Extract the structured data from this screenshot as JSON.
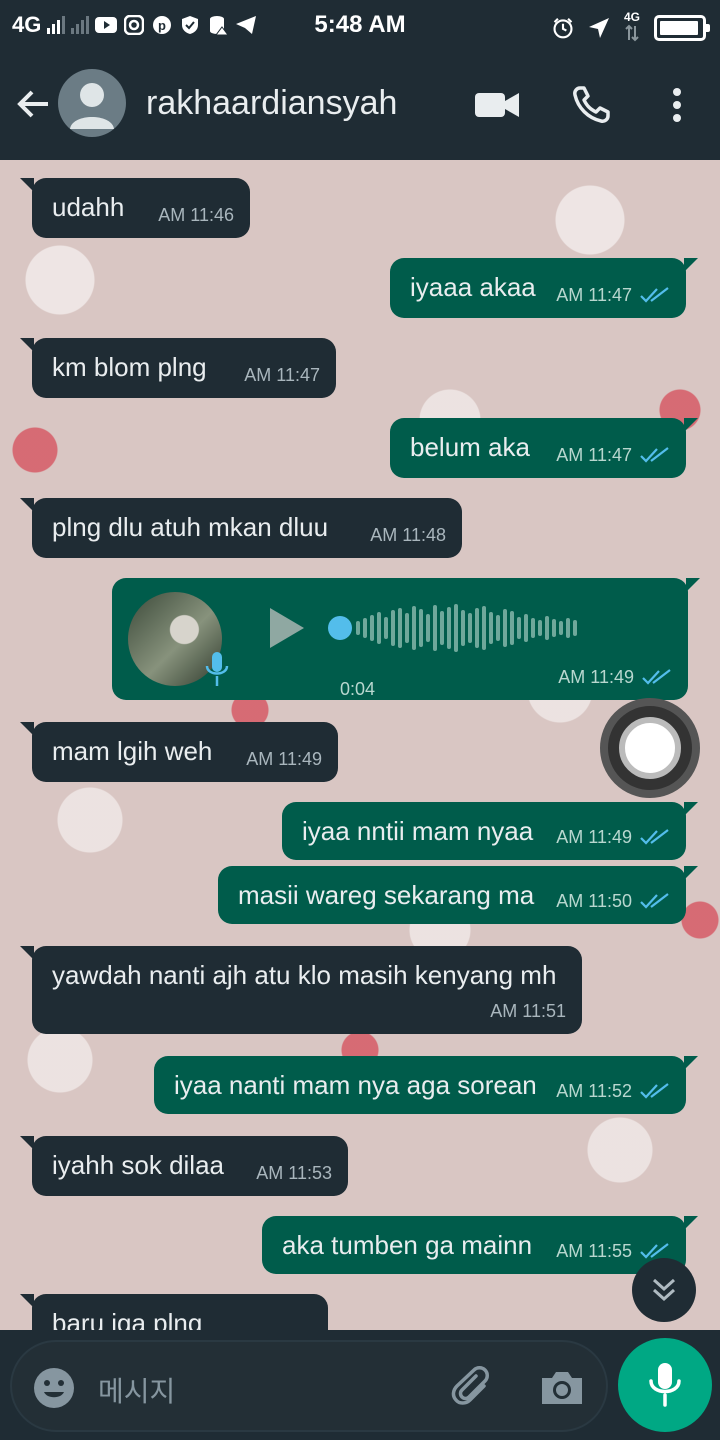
{
  "status_bar": {
    "network": "4G",
    "time": "5:48 AM",
    "right_network": "4G"
  },
  "header": {
    "contact_name": "rakhaardiansyah"
  },
  "messages": [
    {
      "direction": "in",
      "text": "udahh",
      "time": "AM 11:46"
    },
    {
      "direction": "out",
      "text": "iyaaa akaa",
      "time": "AM 11:47",
      "read": true
    },
    {
      "direction": "in",
      "text": "km blom plng",
      "time": "AM 11:47"
    },
    {
      "direction": "out",
      "text": "belum aka",
      "time": "AM 11:47",
      "read": true
    },
    {
      "direction": "in",
      "text": "plng dlu atuh mkan dluu",
      "time": "AM 11:48"
    },
    {
      "direction": "out",
      "type": "voice",
      "duration": "0:04",
      "time": "AM 11:49",
      "read": true
    },
    {
      "direction": "in",
      "text": "mam lgih weh",
      "time": "AM 11:49"
    },
    {
      "direction": "out",
      "text": "iyaa nntii mam nyaa",
      "time": "AM 11:49",
      "read": true
    },
    {
      "direction": "out",
      "text": "masii wareg sekarang ma",
      "time": "AM 11:50",
      "read": true
    },
    {
      "direction": "in",
      "text": "yawdah nanti ajh atu klo masih kenyang mh",
      "time": "AM 11:51"
    },
    {
      "direction": "out",
      "text": "iyaa nanti mam nya aga sorean",
      "time": "AM 11:52",
      "read": true
    },
    {
      "direction": "in",
      "text": "iyahh sok dilaa",
      "time": "AM 11:53"
    },
    {
      "direction": "out",
      "text": "aka tumben ga mainn",
      "time": "AM 11:55",
      "read": true
    },
    {
      "direction": "in",
      "text": "baru iga plng",
      "time": ""
    }
  ],
  "composer": {
    "placeholder": "메시지"
  },
  "colors": {
    "header_bg": "#1f2c34",
    "incoming_bubble": "#1f2c34",
    "outgoing_bubble": "#005c4b",
    "accent": "#00a884",
    "read_ticks": "#53bdeb"
  },
  "icons": [
    "back-arrow-icon",
    "avatar-icon",
    "video-call-icon",
    "phone-icon",
    "more-options-icon",
    "play-icon",
    "mic-icon",
    "double-check-icon",
    "emoji-icon",
    "attach-icon",
    "camera-icon",
    "chevron-down-icon"
  ]
}
